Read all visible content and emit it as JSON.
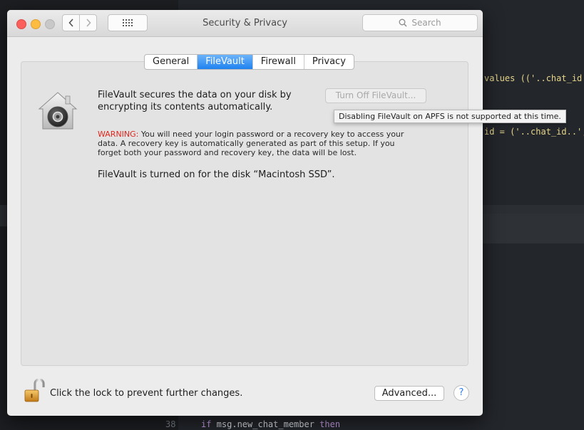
{
  "window": {
    "title": "Security & Privacy",
    "search_placeholder": "Search"
  },
  "tabs": [
    {
      "label": "General",
      "active": false
    },
    {
      "label": "FileVault",
      "active": true
    },
    {
      "label": "Firewall",
      "active": false
    },
    {
      "label": "Privacy",
      "active": false
    }
  ],
  "filevault": {
    "intro": "FileVault secures the data on your disk by encrypting its contents automatically.",
    "warning_label": "WARNING:",
    "warning_text": " You will need your login password or a recovery key to access your data. A recovery key is automatically generated as part of this setup. If you forget both your password and recovery key, the data will be lost.",
    "status": "FileVault is turned on for the disk “Macintosh SSD”.",
    "turn_off_label": "Turn Off FileVault...",
    "tooltip": "Disabling FileVault on APFS is not supported at this time."
  },
  "footer": {
    "lock_text": "Click the lock to prevent further changes.",
    "advanced_label": "Advanced...",
    "help_label": "?"
  },
  "editor": {
    "line1": "values (('..chat_id..",
    "line2": "id = ('..chat_id..',",
    "line_number": "38",
    "line3_kw1": "if",
    "line3_mid": " msg.new_chat_member ",
    "line3_kw2": "then"
  },
  "colors": {
    "accent": "#1f82f0",
    "warning": "#e0261c"
  }
}
